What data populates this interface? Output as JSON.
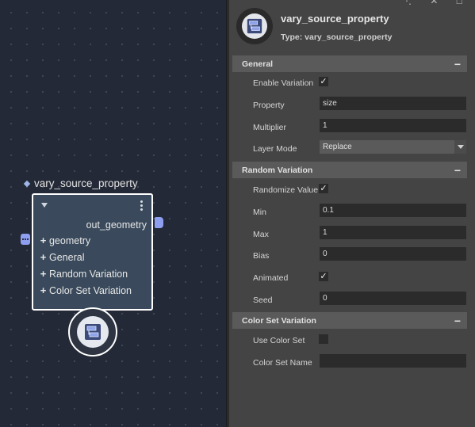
{
  "node_graph": {
    "node_title": "vary_source_property",
    "output_label": "out_geometry",
    "attributes": [
      {
        "label": "geometry"
      },
      {
        "label": "General"
      },
      {
        "label": "Random Variation"
      },
      {
        "label": "Color Set Variation"
      }
    ]
  },
  "header": {
    "name": "vary_source_property",
    "type": "Type: vary_source_property",
    "top_glyphs": "⋱ ✕ □"
  },
  "general": {
    "title": "General",
    "collapse": "−",
    "enable_variation": {
      "label": "Enable Variation",
      "checked": true
    },
    "property": {
      "label": "Property",
      "value": "size"
    },
    "multiplier": {
      "label": "Multiplier",
      "value": "1"
    },
    "layer_mode": {
      "label": "Layer Mode",
      "value": "Replace"
    }
  },
  "random_variation": {
    "title": "Random Variation",
    "collapse": "−",
    "randomize_value": {
      "label": "Randomize Value",
      "checked": true
    },
    "min": {
      "label": "Min",
      "value": "0.1"
    },
    "max": {
      "label": "Max",
      "value": "1"
    },
    "bias": {
      "label": "Bias",
      "value": "0"
    },
    "animated": {
      "label": "Animated",
      "checked": true
    },
    "seed": {
      "label": "Seed",
      "value": "0"
    }
  },
  "color_set_variation": {
    "title": "Color Set Variation",
    "collapse": "−",
    "use_color_set": {
      "label": "Use Color Set",
      "checked": false
    },
    "color_set_name": {
      "label": "Color Set Name",
      "value": ""
    }
  },
  "icons": {
    "node_type_icon": "node-type-icon",
    "checkmark": "✓"
  },
  "colors": {
    "canvas_bg": "#232936",
    "node_body": "#3a4a5c",
    "port": "#8f9ff0",
    "panel_bg": "#444444",
    "section_bg": "#5a5a5a",
    "field_bg": "#2b2b2b"
  }
}
